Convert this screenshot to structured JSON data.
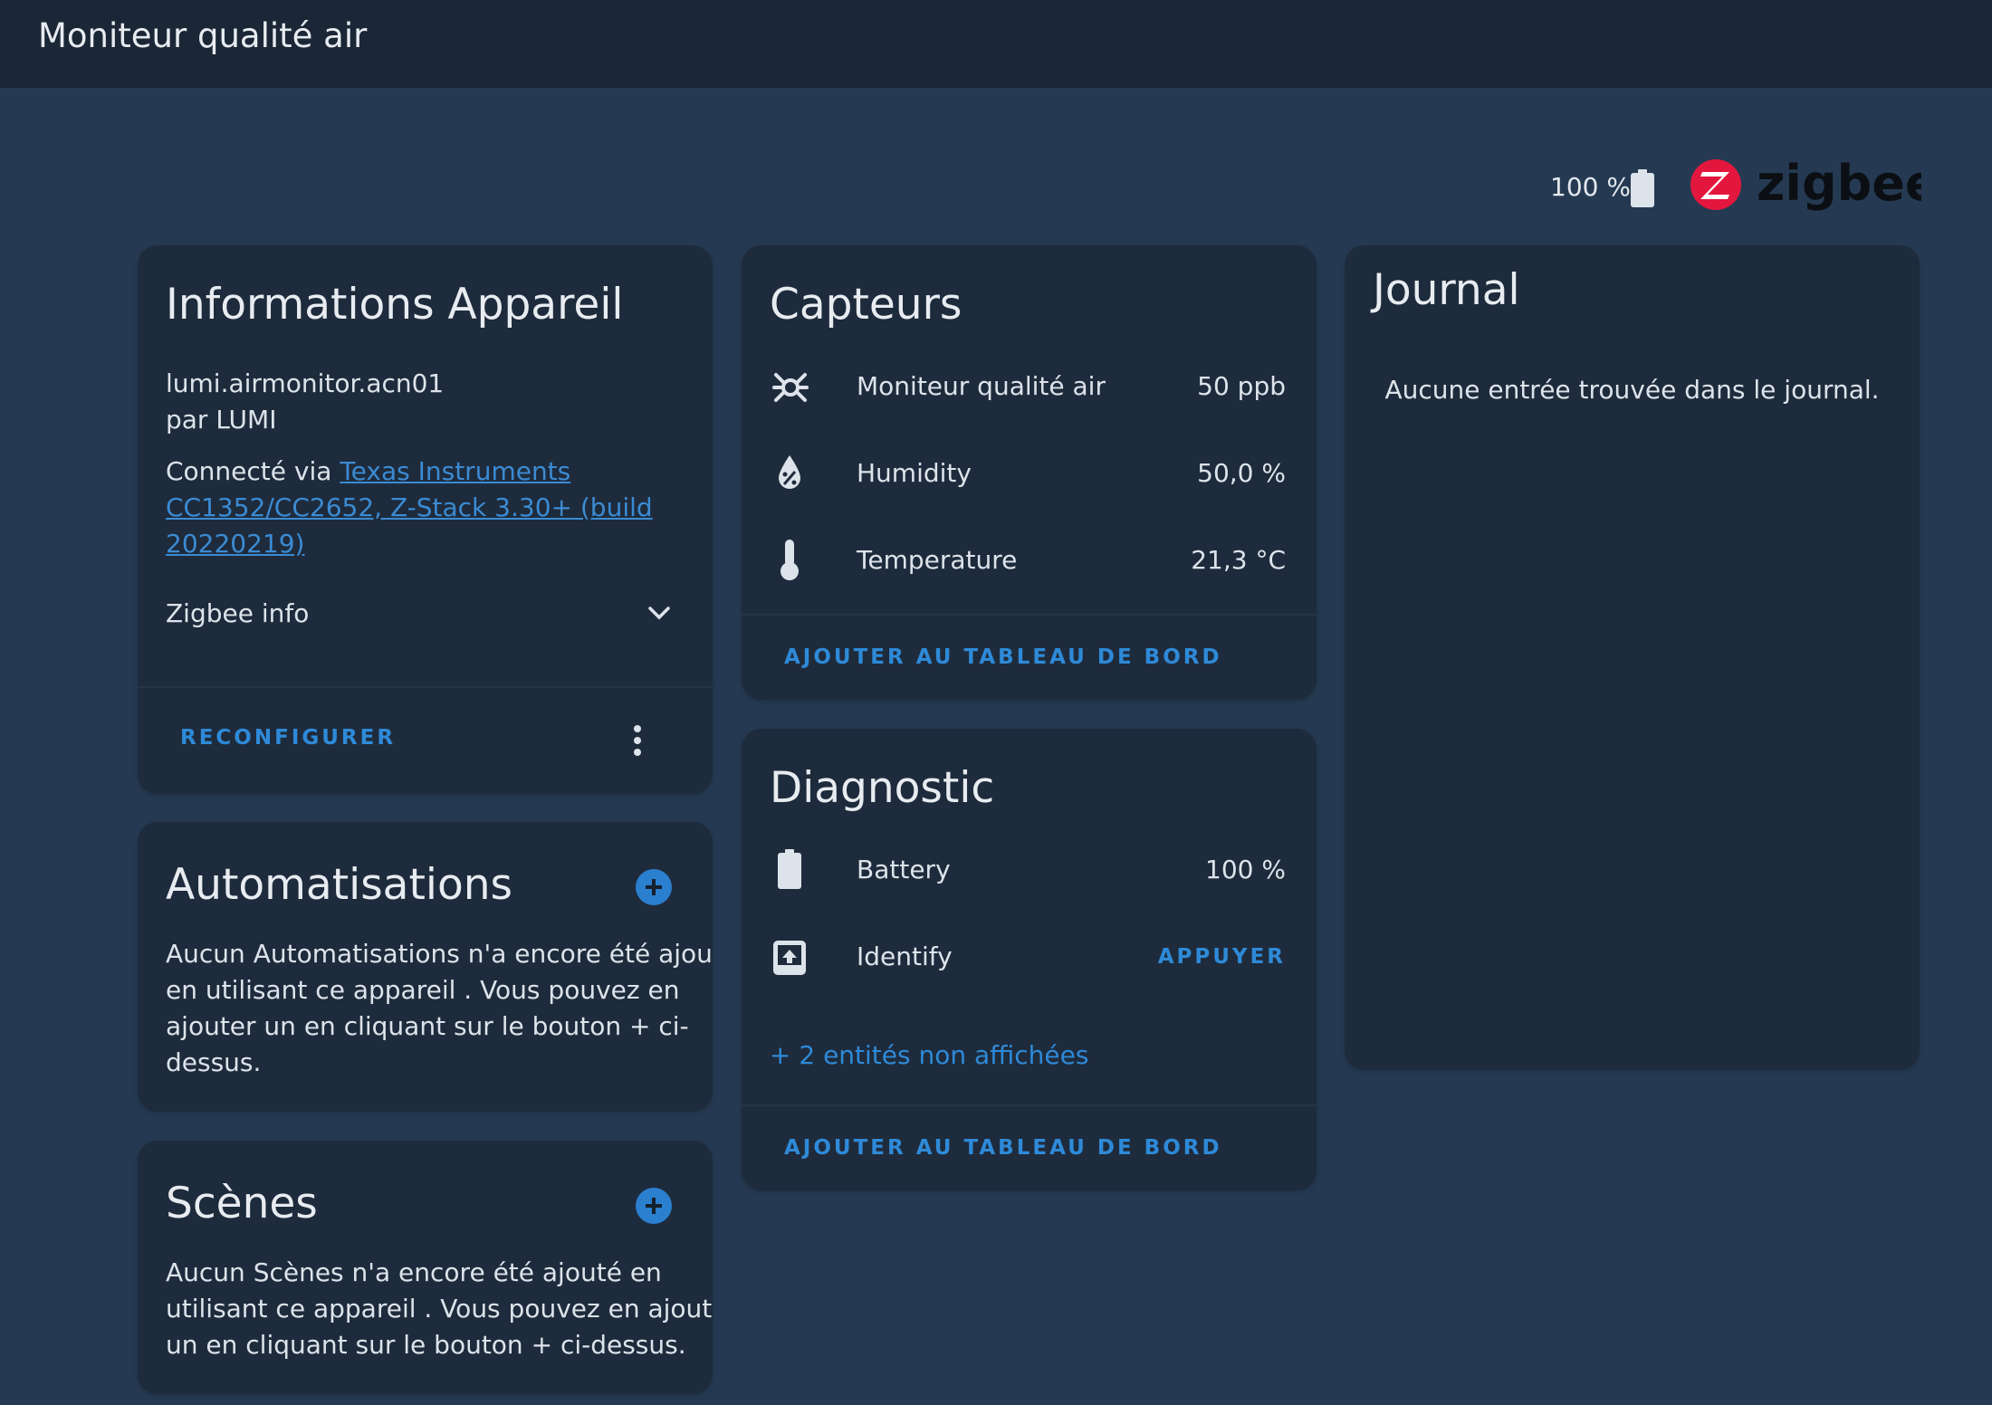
{
  "header": {
    "title": "Moniteur qualité air"
  },
  "status": {
    "battery_label": "100 %",
    "logo_text": "zigbee",
    "battery_icon": "battery-icon",
    "logo_icon": "zigbee-logo"
  },
  "device_info": {
    "title": "Informations Appareil",
    "model": "lumi.airmonitor.acn01",
    "manufacturer": "par LUMI",
    "connected_prefix": "Connecté via ",
    "connected_link_line1": "Texas Instruments",
    "connected_link_line2": "CC1352/CC2652, Z-Stack 3.30+ (build",
    "connected_link_line3": "20220219)",
    "zigbee_info": "Zigbee info",
    "reconfigure": "RECONFIGURER"
  },
  "automations": {
    "title": "Automatisations",
    "lines": [
      "Aucun Automatisations n'a encore été ajouté",
      "en utilisant ce appareil . Vous pouvez en",
      "ajouter un en cliquant sur le bouton + ci-",
      "dessus."
    ]
  },
  "scenes": {
    "title": "Scènes",
    "lines": [
      "Aucun Scènes n'a encore été ajouté en",
      "utilisant ce appareil . Vous pouvez en ajouter",
      "un en cliquant sur le bouton + ci-dessus."
    ]
  },
  "sensors": {
    "title": "Capteurs",
    "rows": [
      {
        "icon": "air-filter-icon",
        "label": "Moniteur qualité air",
        "value": "50 ppb"
      },
      {
        "icon": "water-percent-icon",
        "label": "Humidity",
        "value": "50,0 %"
      },
      {
        "icon": "thermometer-icon",
        "label": "Temperature",
        "value": "21,3 °C"
      }
    ],
    "add_dashboard": "AJOUTER AU TABLEAU DE BORD"
  },
  "diagnostic": {
    "title": "Diagnostic",
    "rows": [
      {
        "icon": "battery-icon",
        "label": "Battery",
        "value": "100 %"
      },
      {
        "icon": "tray-arrow-up-icon",
        "label": "Identify",
        "value": "APPUYER"
      }
    ],
    "hidden_entities": "+ 2 entités non affichées",
    "add_dashboard": "AJOUTER AU TABLEAU DE BORD"
  },
  "journal": {
    "title": "Journal",
    "empty": "Aucune entrée trouvée dans le journal."
  },
  "colors": {
    "accent": "#2e8ad8",
    "background": "#253a52",
    "card": "#1e2b3c",
    "zigbee_red": "#e3173e"
  }
}
